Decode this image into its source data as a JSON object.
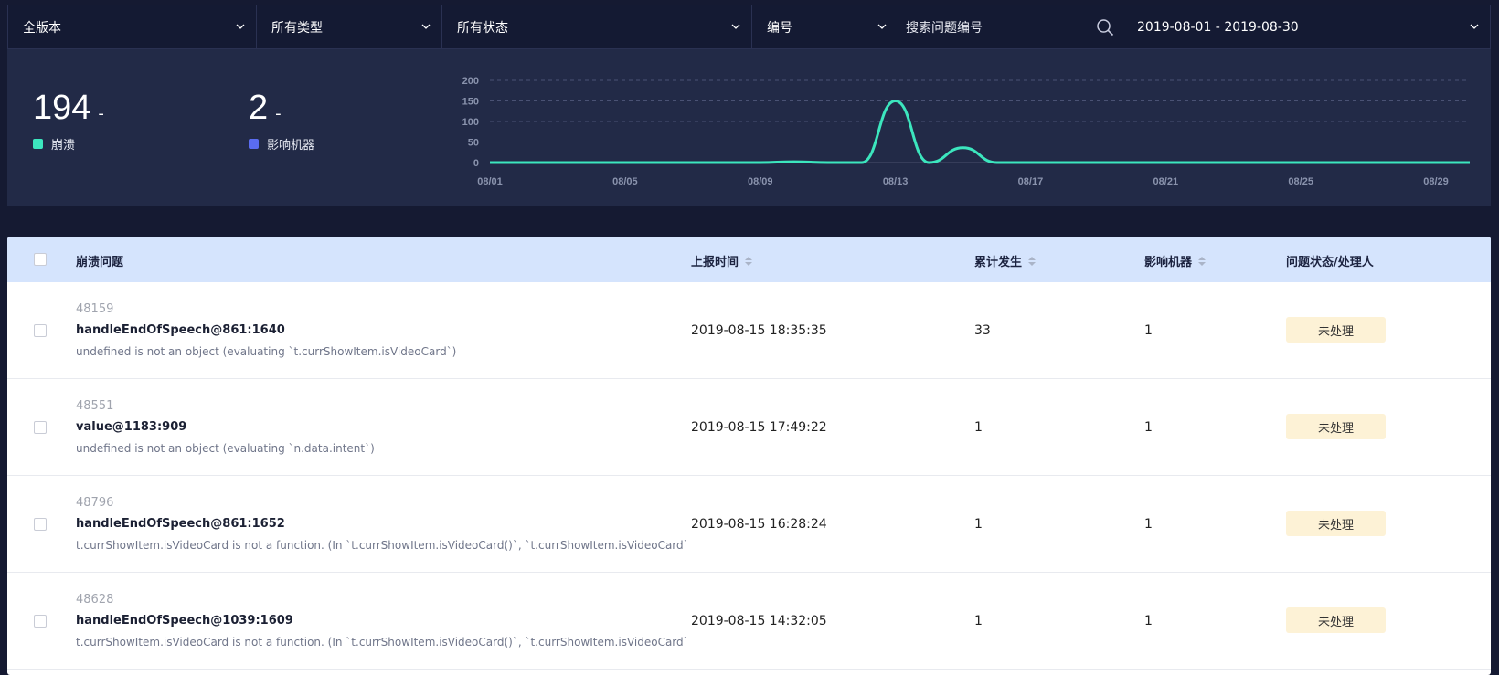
{
  "filters": {
    "version": "全版本",
    "type": "所有类型",
    "status": "所有状态",
    "field": "编号",
    "search_placeholder": "搜索问题编号",
    "date_range": "2019-08-01 - 2019-08-30"
  },
  "stats": [
    {
      "value": "194",
      "dash": "-",
      "label": "崩溃",
      "color": "#3ce6be"
    },
    {
      "value": "2",
      "dash": "-",
      "label": "影响机器",
      "color": "#5a6cf0"
    }
  ],
  "chart_data": {
    "type": "line",
    "y_ticks": [
      "200",
      "150",
      "100",
      "50",
      "0"
    ],
    "ylim": [
      0,
      200
    ],
    "x_tick_labels": [
      "08/01",
      "08/05",
      "08/09",
      "08/13",
      "08/17",
      "08/21",
      "08/25",
      "08/29"
    ],
    "series": [
      {
        "color": "#3ce6be",
        "x": [
          "08/01",
          "08/02",
          "08/03",
          "08/04",
          "08/05",
          "08/06",
          "08/07",
          "08/08",
          "08/09",
          "08/10",
          "08/11",
          "08/12",
          "08/13",
          "08/14",
          "08/15",
          "08/16",
          "08/17",
          "08/18",
          "08/19",
          "08/20",
          "08/21",
          "08/22",
          "08/23",
          "08/24",
          "08/25",
          "08/26",
          "08/27",
          "08/28",
          "08/29",
          "08/30"
        ],
        "values": [
          0,
          0,
          0,
          0,
          0,
          0,
          0,
          0,
          0,
          2,
          0,
          0,
          150,
          0,
          36,
          0,
          0,
          0,
          0,
          0,
          0,
          0,
          0,
          0,
          0,
          0,
          0,
          0,
          0,
          0
        ]
      }
    ],
    "grid": true
  },
  "table": {
    "headers": {
      "problem": "崩溃问题",
      "time": "上报时间",
      "count": "累计发生",
      "machines": "影响机器",
      "status": "问题状态/处理人"
    },
    "rows": [
      {
        "id": "48159",
        "fn": "handleEndOfSpeech@861:1640",
        "msg": "undefined is not an object (evaluating `t.currShowItem.isVideoCard`)",
        "time": "2019-08-15 18:35:35",
        "count": "33",
        "machines": "1",
        "status": "未处理"
      },
      {
        "id": "48551",
        "fn": "value@1183:909",
        "msg": "undefined is not an object (evaluating `n.data.intent`)",
        "time": "2019-08-15 17:49:22",
        "count": "1",
        "machines": "1",
        "status": "未处理"
      },
      {
        "id": "48796",
        "fn": "handleEndOfSpeech@861:1652",
        "msg": "t.currShowItem.isVideoCard is not a function. (In `t.currShowItem.isVideoCard()`, `t.currShowItem.isVideoCard` is u",
        "time": "2019-08-15 16:28:24",
        "count": "1",
        "machines": "1",
        "status": "未处理"
      },
      {
        "id": "48628",
        "fn": "handleEndOfSpeech@1039:1609",
        "msg": "t.currShowItem.isVideoCard is not a function. (In `t.currShowItem.isVideoCard()`, `t.currShowItem.isVideoCard` is u",
        "time": "2019-08-15 14:32:05",
        "count": "1",
        "machines": "1",
        "status": "未处理"
      }
    ]
  }
}
